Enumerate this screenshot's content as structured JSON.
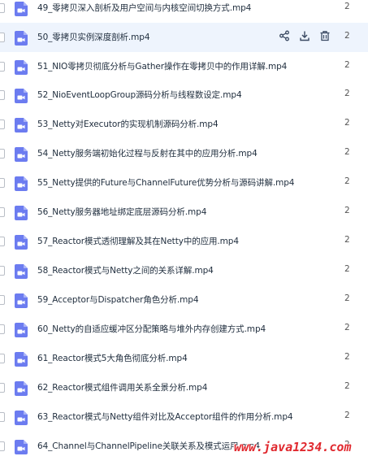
{
  "files": [
    {
      "name": "49_零拷贝深入剖析及用户空间与内核空间切换方式.mp4",
      "num": "2"
    },
    {
      "name": "50_零拷贝实例深度剖析.mp4",
      "num": "2",
      "hover": true
    },
    {
      "name": "51_NIO零拷贝彻底分析与Gather操作在零拷贝中的作用详解.mp4",
      "num": "2"
    },
    {
      "name": "52_NioEventLoopGroup源码分析与线程数设定.mp4",
      "num": "2"
    },
    {
      "name": "53_Netty对Executor的实现机制源码分析.mp4",
      "num": "2"
    },
    {
      "name": "54_Netty服务端初始化过程与反射在其中的应用分析.mp4",
      "num": "2"
    },
    {
      "name": "55_Netty提供的Future与ChannelFuture优势分析与源码讲解.mp4",
      "num": "2"
    },
    {
      "name": "56_Netty服务器地址绑定底层源码分析.mp4",
      "num": "2"
    },
    {
      "name": "57_Reactor模式透彻理解及其在Netty中的应用.mp4",
      "num": "2"
    },
    {
      "name": "58_Reactor模式与Netty之间的关系详解.mp4",
      "num": "2"
    },
    {
      "name": "59_Acceptor与Dispatcher角色分析.mp4",
      "num": "2"
    },
    {
      "name": "60_Netty的自适应缓冲区分配策略与堆外内存创建方式.mp4",
      "num": "2"
    },
    {
      "name": "61_Reactor模式5大角色彻底分析.mp4",
      "num": "2"
    },
    {
      "name": "62_Reactor模式组件调用关系全景分析.mp4",
      "num": "2"
    },
    {
      "name": "63_Reactor模式与Netty组件对比及Acceptor组件的作用分析.mp4",
      "num": "2"
    },
    {
      "name": "64_Channel与ChannelPipeline关联关系及模式运用.mp4",
      "num": "2"
    }
  ],
  "icons": {
    "file": "video-file-icon",
    "share": "share-icon",
    "download": "download-icon",
    "delete": "trash-icon"
  },
  "colors": {
    "file_icon": "#6c7cf0",
    "hover_bg": "#eef4fd",
    "action_icon": "#3b4a63",
    "watermark": "#e0282e"
  },
  "watermark": "www.java1234.com"
}
